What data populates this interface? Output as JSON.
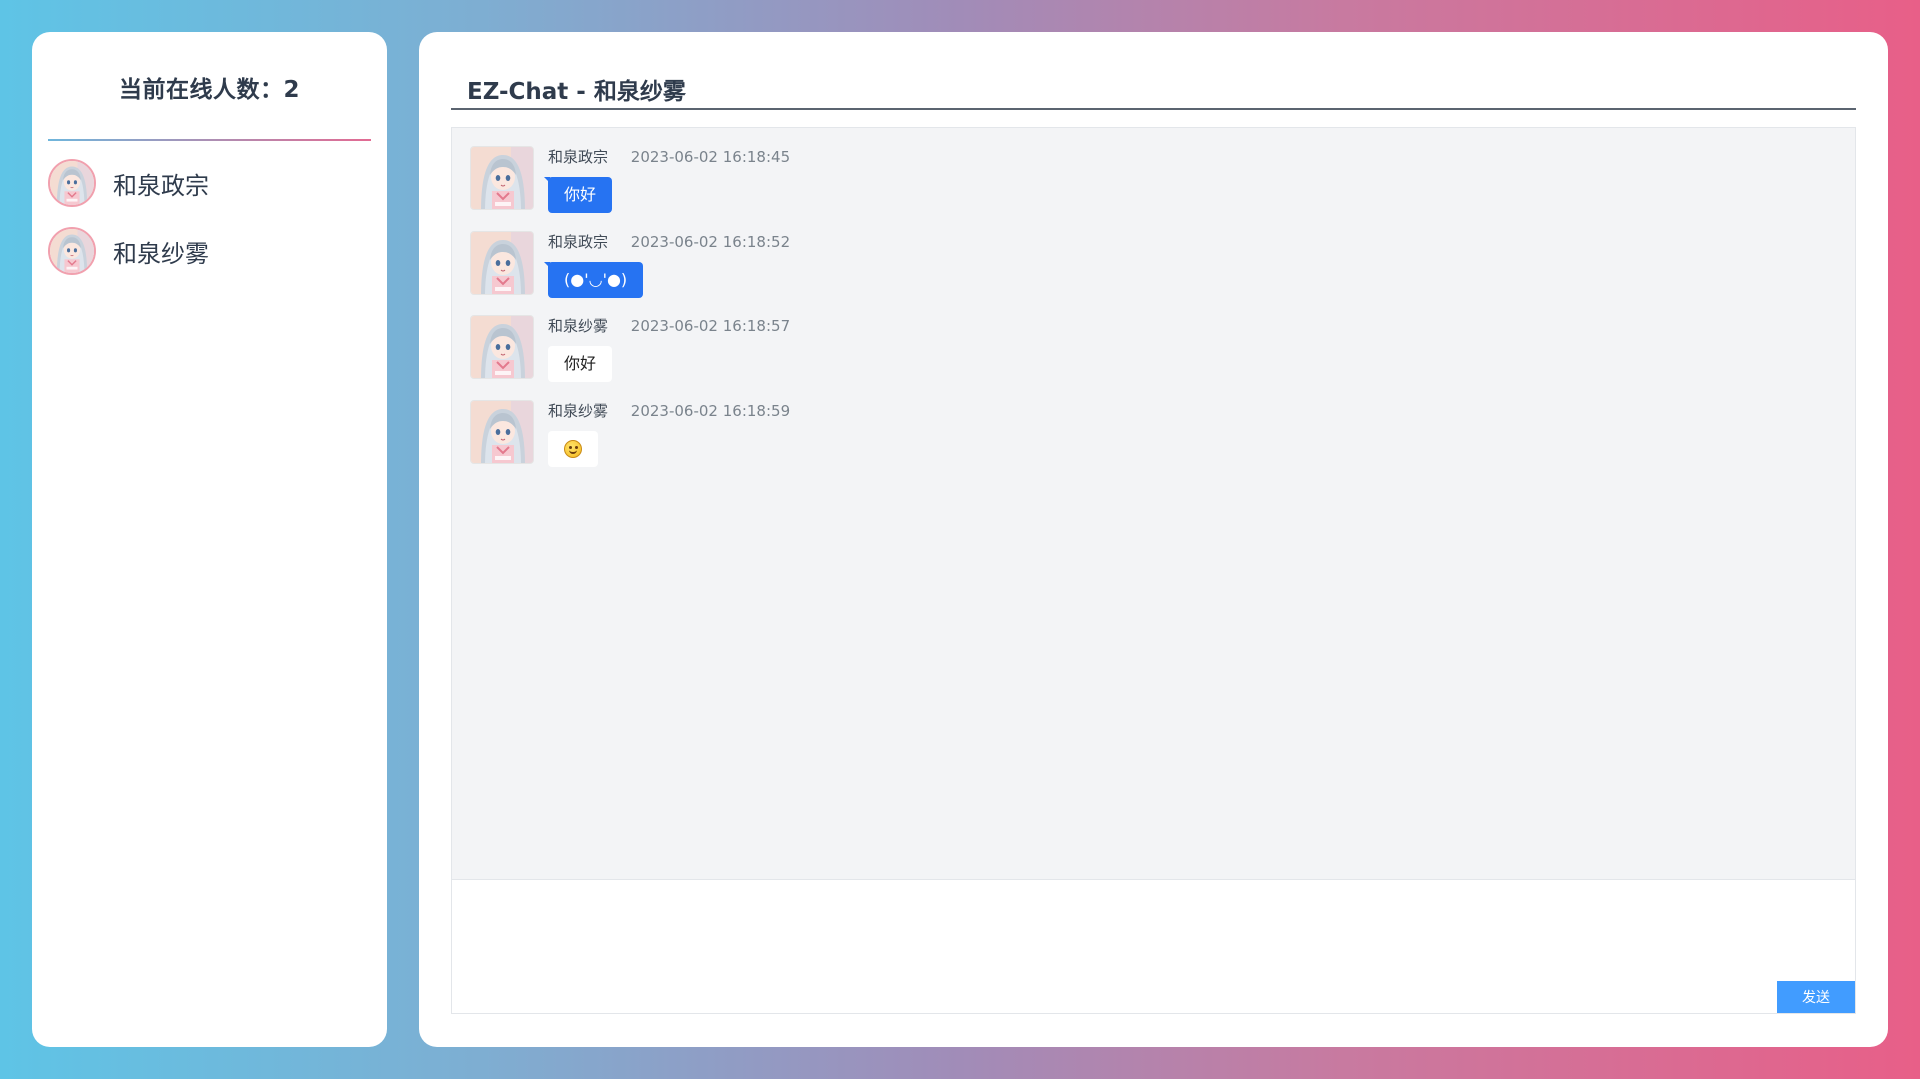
{
  "sidebar": {
    "online_label": "当前在线人数：2",
    "users": [
      {
        "name": "和泉政宗"
      },
      {
        "name": "和泉纱雾"
      }
    ]
  },
  "chat": {
    "title": "EZ-Chat - 和泉纱雾",
    "messages": [
      {
        "sender": "和泉政宗",
        "time": "2023-06-02 16:18:45",
        "text": "你好",
        "style": "blue"
      },
      {
        "sender": "和泉政宗",
        "time": "2023-06-02 16:18:52",
        "text": "(●'◡'●)",
        "style": "blue"
      },
      {
        "sender": "和泉纱雾",
        "time": "2023-06-02 16:18:57",
        "text": "你好",
        "style": "white"
      },
      {
        "sender": "和泉纱雾",
        "time": "2023-06-02 16:18:59",
        "text": "",
        "icon": "smiling-face-emoji",
        "style": "white"
      }
    ],
    "input": {
      "value": ""
    },
    "send_label": "发送"
  },
  "colors": {
    "bubble_blue": "#2673f2",
    "send_button": "#419cff",
    "gradient_left": "#5ec4e6",
    "gradient_right": "#e85f88"
  }
}
